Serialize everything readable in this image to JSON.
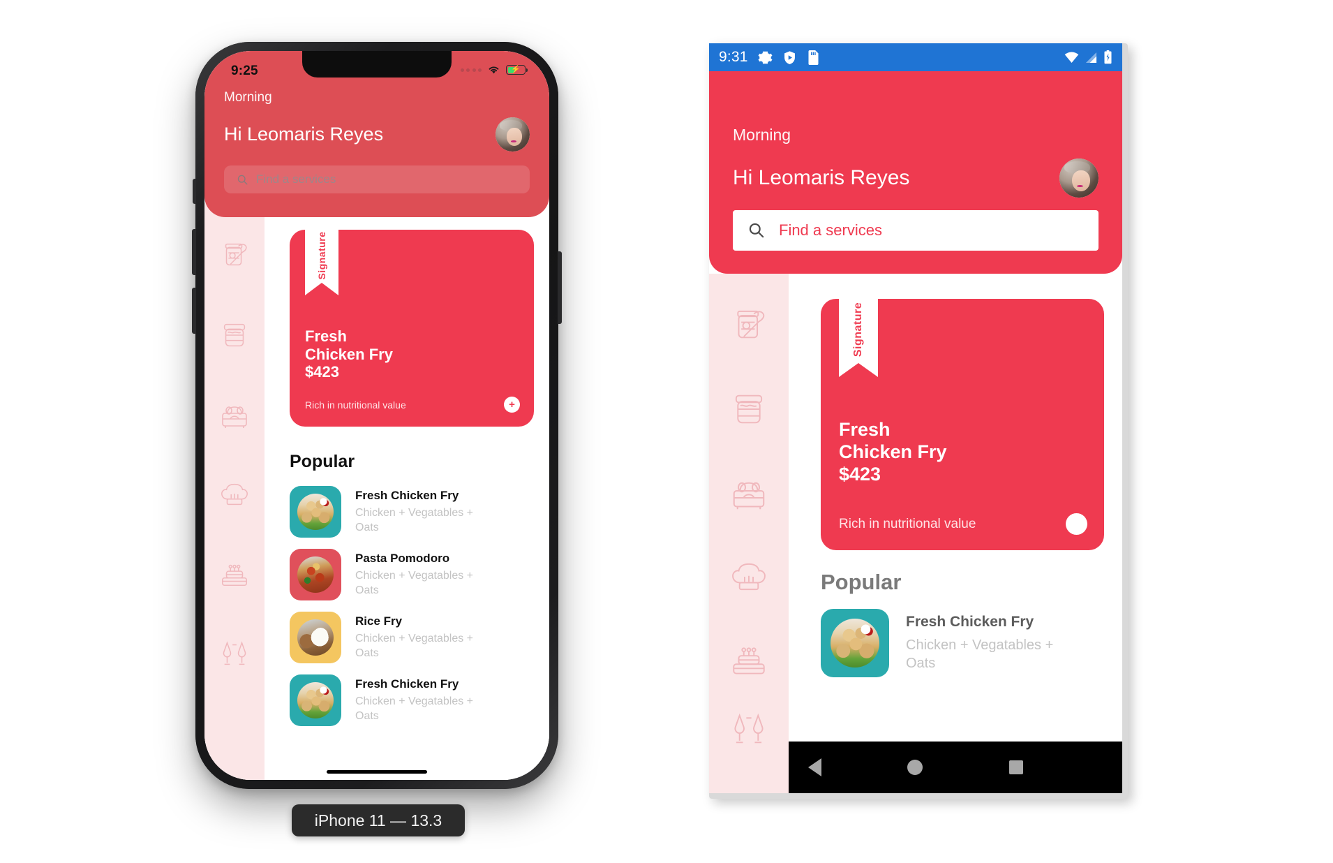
{
  "app": {
    "brand_red": "#ef3a50",
    "brand_red_ios": "#dd4e55",
    "sidebar_bg": "#fbe6e7",
    "greeting": "Morning",
    "username": "Hi Leomaris Reyes",
    "search_placeholder": "Find a services",
    "search_value": "",
    "sidebar_icons": [
      {
        "name": "jam-jar-spoon-icon",
        "label": "Jam jar with spoon"
      },
      {
        "name": "preserve-jar-icon",
        "label": "Preserve jar"
      },
      {
        "name": "picnic-basket-icon",
        "label": "Picnic basket"
      },
      {
        "name": "chef-hat-icon",
        "label": "Chef hat"
      },
      {
        "name": "cake-icon",
        "label": "Layer cake"
      },
      {
        "name": "champagne-glasses-icon",
        "label": "Champagne glasses"
      }
    ],
    "hero": {
      "ribbon": "Signature",
      "title_line1": "Fresh",
      "title_line2": "Chicken Fry",
      "price": "$423",
      "subtitle": "Rich in nutritional value",
      "add_button": "+",
      "image": "fried-chicken-photo"
    },
    "popular": {
      "heading": "Popular",
      "items": [
        {
          "name": "Fresh Chicken Fry",
          "desc": "Chicken + Vegatables + Oats",
          "swatch": "#2aaaad",
          "image": "fried-chicken-photo"
        },
        {
          "name": "Pasta Pomodoro",
          "desc": "Chicken + Vegatables + Oats",
          "swatch": "#e0505b",
          "image": "pasta-photo"
        },
        {
          "name": "Rice Fry",
          "desc": "Chicken + Vegatables + Oats",
          "swatch": "#f4c660",
          "image": "rice-bowl-photo"
        },
        {
          "name": "Fresh Chicken Fry",
          "desc": "Chicken + Vegatables + Oats",
          "swatch": "#2aaaad",
          "image": "fried-chicken-photo"
        }
      ]
    }
  },
  "ios_device": {
    "label": "iPhone 11 — 13.3",
    "status": {
      "time": "9:25",
      "signal_icon": "signal-dots-icon",
      "wifi_icon": "wifi-icon",
      "battery_icon": "battery-charging-icon"
    },
    "home_indicator": "home-indicator"
  },
  "android_device": {
    "status": {
      "time": "9:31",
      "left_icons": [
        "gear-icon",
        "shield-play-icon",
        "sd-card-icon"
      ],
      "right_icons": [
        "wifi-icon",
        "cell-signal-icon",
        "battery-charging-icon"
      ],
      "bar_color": "#1f74d4"
    },
    "navbar": {
      "back": "back-triangle-icon",
      "home": "home-circle-icon",
      "recents": "recents-square-icon"
    }
  }
}
